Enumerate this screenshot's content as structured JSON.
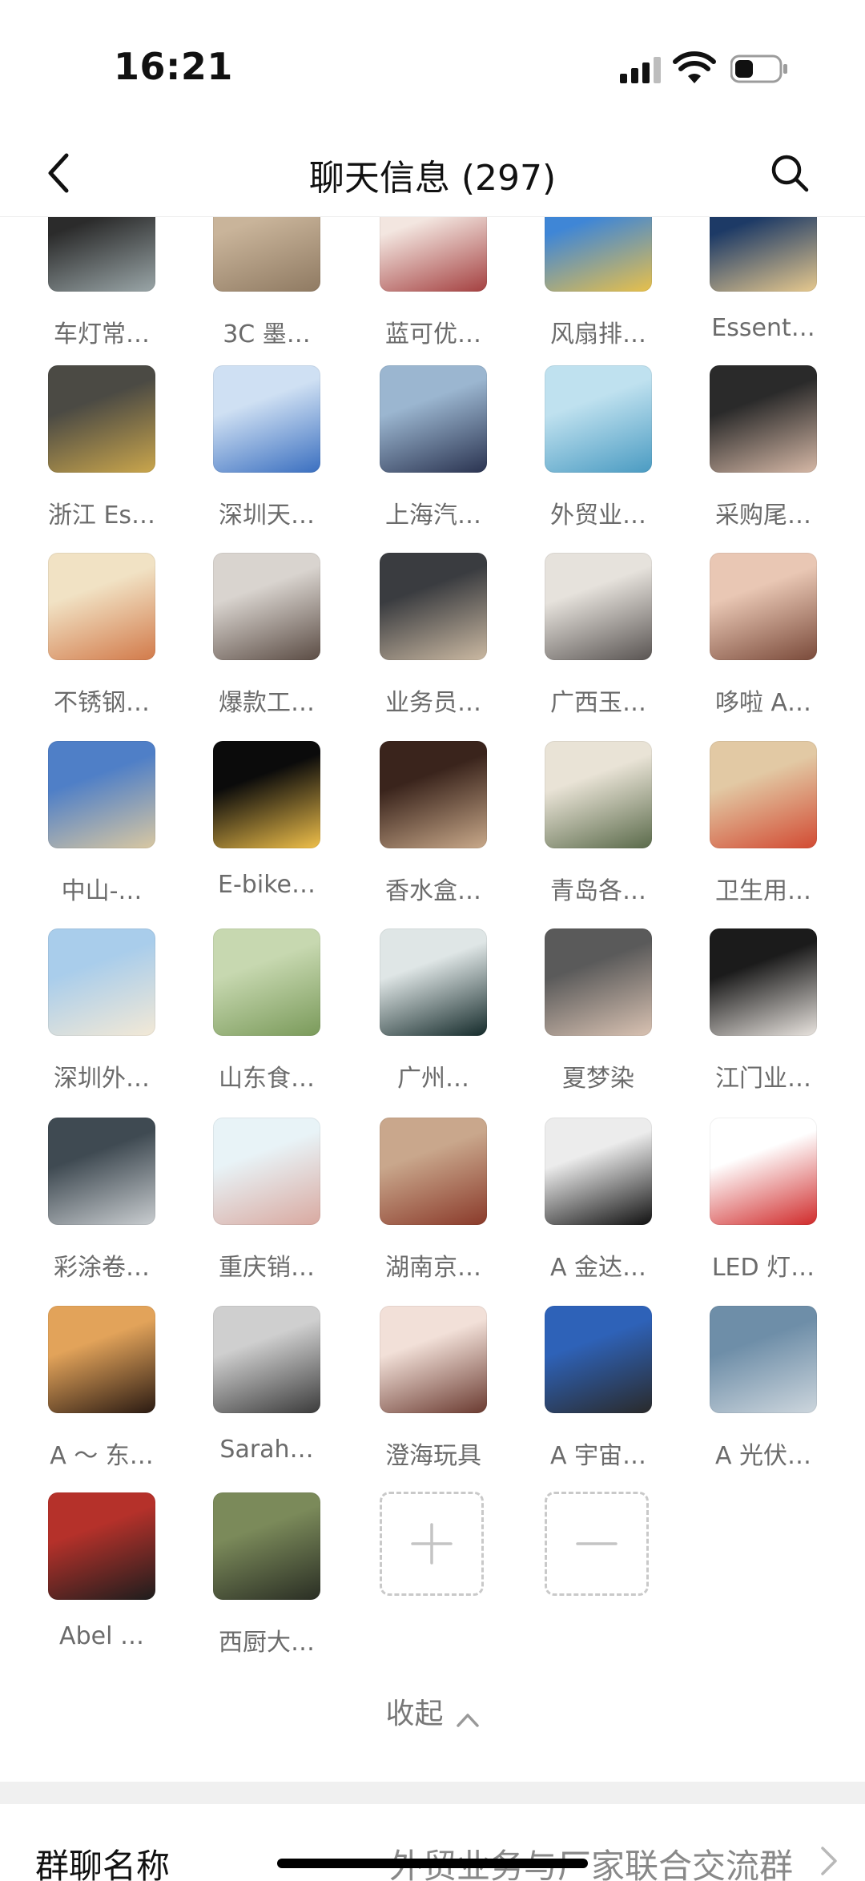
{
  "status_bar": {
    "time": "16:21"
  },
  "nav": {
    "title": "聊天信息 (297)",
    "back_icon": "chevron-left-icon",
    "search_icon": "search-icon"
  },
  "members": [
    {
      "name": "车灯常…",
      "colors": [
        "#2b2b2b",
        "#9aa6a8"
      ]
    },
    {
      "name": "3C 墨…",
      "colors": [
        "#c9b49a",
        "#8f7a62"
      ]
    },
    {
      "name": "蓝可优…",
      "colors": [
        "#f3e6e0",
        "#a44040"
      ]
    },
    {
      "name": "风扇排…",
      "colors": [
        "#3f86d6",
        "#e8c04a"
      ]
    },
    {
      "name": "Essent…",
      "colors": [
        "#1d3a66",
        "#e7c98e"
      ]
    },
    {
      "name": "浙江 Es…",
      "colors": [
        "#4b4a44",
        "#caa64c"
      ]
    },
    {
      "name": "深圳天…",
      "colors": [
        "#cfe0f3",
        "#3a6fc0"
      ]
    },
    {
      "name": "上海汽…",
      "colors": [
        "#9bb6d0",
        "#2a3350"
      ]
    },
    {
      "name": "外贸业…",
      "colors": [
        "#bfe1ef",
        "#4a9bc2"
      ]
    },
    {
      "name": "采购尾…",
      "colors": [
        "#2a2a2a",
        "#d6b8a6"
      ]
    },
    {
      "name": "不锈钢…",
      "colors": [
        "#f1e2c4",
        "#d27a4a"
      ]
    },
    {
      "name": "爆款工…",
      "colors": [
        "#d9d4cf",
        "#5b4c44"
      ]
    },
    {
      "name": "业务员…",
      "colors": [
        "#3a3c40",
        "#cbb9a2"
      ]
    },
    {
      "name": "广西玉…",
      "colors": [
        "#e6e2dc",
        "#595452"
      ]
    },
    {
      "name": "哆啦 A…",
      "colors": [
        "#e9c7b4",
        "#7a4a3a"
      ]
    },
    {
      "name": "中山-…",
      "colors": [
        "#4f7fc7",
        "#d9c8a2"
      ]
    },
    {
      "name": "E-bike…",
      "colors": [
        "#0b0b0b",
        "#f0c04a"
      ]
    },
    {
      "name": "香水盒…",
      "colors": [
        "#3a241c",
        "#c9a98a"
      ]
    },
    {
      "name": "青岛各…",
      "colors": [
        "#e9e3d6",
        "#5a6a4a"
      ]
    },
    {
      "name": "卫生用…",
      "colors": [
        "#e2c9a4",
        "#d24a32"
      ]
    },
    {
      "name": "深圳外…",
      "colors": [
        "#a9cdeb",
        "#f3e9d6"
      ]
    },
    {
      "name": "山东食…",
      "colors": [
        "#c7d8b0",
        "#7a9a5a"
      ]
    },
    {
      "name": "广州…",
      "colors": [
        "#dfe6e6",
        "#142a2a"
      ]
    },
    {
      "name": "夏梦染",
      "colors": [
        "#5a5a5a",
        "#d9c2b2"
      ]
    },
    {
      "name": "江门业…",
      "colors": [
        "#1b1b1b",
        "#e9e4df"
      ]
    },
    {
      "name": "彩涂卷…",
      "colors": [
        "#3f4a52",
        "#c9cdd0"
      ]
    },
    {
      "name": "重庆销…",
      "colors": [
        "#e8f3f7",
        "#d9a9a0"
      ]
    },
    {
      "name": "湖南京…",
      "colors": [
        "#c9a78c",
        "#8a3a2a"
      ]
    },
    {
      "name": "A 金达…",
      "colors": [
        "#ececec",
        "#111111"
      ]
    },
    {
      "name": "LED 灯…",
      "colors": [
        "#ffffff",
        "#d02a2a"
      ]
    },
    {
      "name": "A ～ 东…",
      "colors": [
        "#e2a35a",
        "#2a1a12"
      ]
    },
    {
      "name": "Sarah…",
      "colors": [
        "#cfcfcf",
        "#3b3b3b"
      ]
    },
    {
      "name": "澄海玩具",
      "colors": [
        "#f2e0d8",
        "#6a3a30"
      ]
    },
    {
      "name": "A 宇宙…",
      "colors": [
        "#2e62b8",
        "#2a2a2a"
      ]
    },
    {
      "name": "A 光伏…",
      "colors": [
        "#6e8ea8",
        "#cdd6dd"
      ]
    },
    {
      "name": "Abel …",
      "colors": [
        "#b5312a",
        "#1d1d1d"
      ]
    },
    {
      "name": "西厨大…",
      "colors": [
        "#7b8a5a",
        "#2a2e24"
      ]
    }
  ],
  "actions": {
    "add_icon": "plus-icon",
    "remove_icon": "minus-icon"
  },
  "collapse": {
    "label": "收起"
  },
  "group_name": {
    "label": "群聊名称",
    "value": "外贸业务与厂家联合交流群"
  }
}
